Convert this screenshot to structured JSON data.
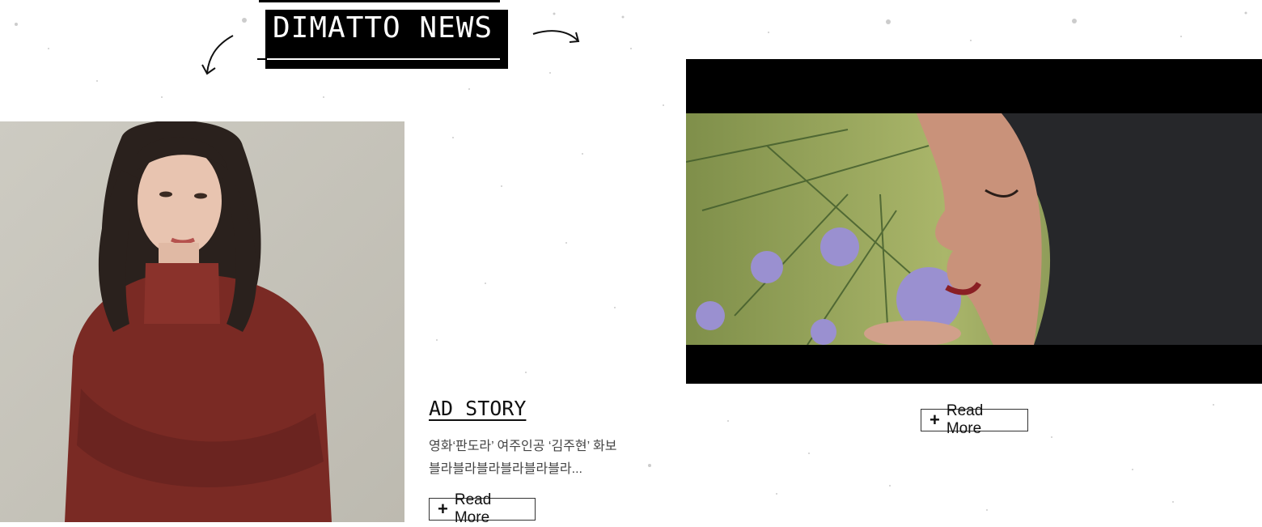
{
  "header": {
    "title": "DIMATTO NEWS",
    "left_arrow_icon": "curved-arrow-down-left-icon",
    "right_arrow_icon": "curved-arrow-right-icon"
  },
  "story": {
    "title": "AD STORY",
    "line1": "영화‘판도라’ 여주인공 ‘김주현’ 화보",
    "line2": "블라블라블라블라블라블라...",
    "read_more": "Read More"
  },
  "video": {
    "read_more": "Read More",
    "plus_icon": "plus-icon"
  },
  "colors": {
    "badge": "#000000",
    "sweater": "#7a2a24",
    "background": "#ffffff"
  }
}
